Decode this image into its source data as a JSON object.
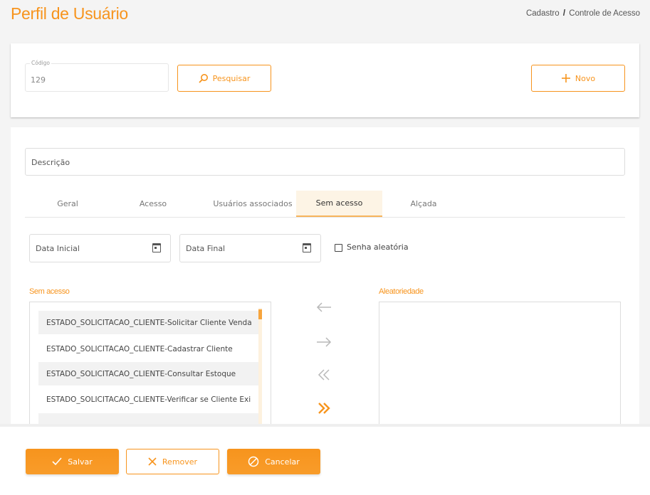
{
  "header": {
    "title": "Perfil de Usuário",
    "breadcrumb": [
      "Cadastro",
      "Controle de Acesso"
    ],
    "separator": "/"
  },
  "search_card": {
    "code_label": "Código",
    "code_value": "129",
    "search_button": "Pesquisar",
    "new_button": "Novo"
  },
  "form": {
    "description_label": "Descrição",
    "tabs": [
      {
        "label": "Geral",
        "active": false
      },
      {
        "label": "Acesso",
        "active": false
      },
      {
        "label": "Usuários associados",
        "active": false
      },
      {
        "label": "Sem acesso",
        "active": true
      },
      {
        "label": "Alçada",
        "active": false
      }
    ],
    "start_date_label": "Data Inicial",
    "end_date_label": "Data Final",
    "random_password_label": "Senha aleatória",
    "left_list_title": "Sem acesso",
    "right_list_title": "Aleatoriedade",
    "left_items": [
      "ESTADO_SOLICITACAO_CLIENTE-Solicitar Cliente Venda",
      "ESTADO_SOLICITACAO_CLIENTE-Cadastrar Cliente",
      "ESTADO_SOLICITACAO_CLIENTE-Consultar Estoque",
      "ESTADO_SOLICITACAO_CLIENTE-Verificar se Cliente Exi",
      ""
    ]
  },
  "footer": {
    "save_button": "Salvar",
    "remove_button": "Remover",
    "cancel_button": "Cancelar"
  },
  "colors": {
    "accent": "#f7941d",
    "tab_active_bg": "#fdf4e5",
    "arrow_inactive": "#b8b8b8"
  },
  "icons": [
    "search-icon",
    "plus-icon",
    "calendar-icon",
    "arrow-left-icon",
    "arrow-right-icon",
    "double-left-icon",
    "double-right-icon",
    "check-icon",
    "x-icon",
    "ban-icon"
  ]
}
